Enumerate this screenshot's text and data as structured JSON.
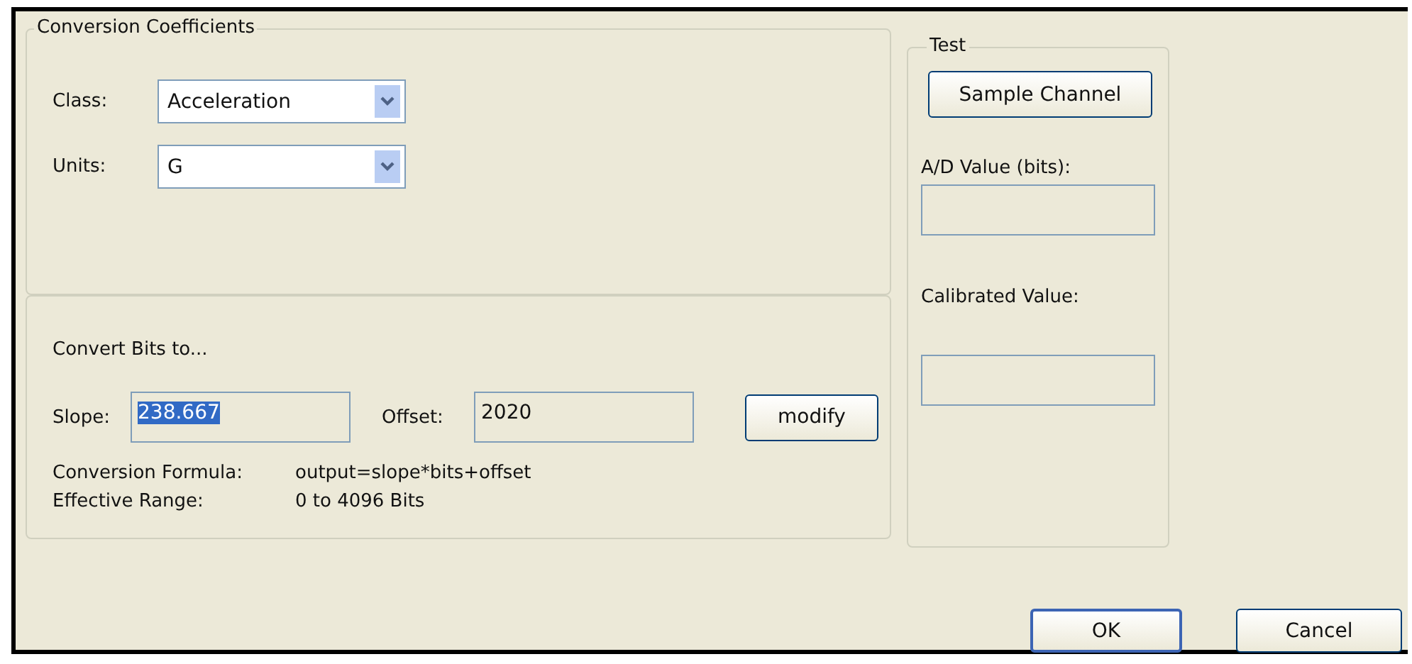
{
  "conversion_coefficients": {
    "title": "Conversion Coefficients",
    "dropdowns": [
      {
        "label": "Class:",
        "value": "Acceleration"
      },
      {
        "label": "Units:",
        "value": "G"
      }
    ]
  },
  "convert": {
    "heading": "Convert Bits to...",
    "slope": {
      "label": "Slope:",
      "value": "238.667",
      "selected": true
    },
    "offset": {
      "label": "Offset:",
      "value": "2020",
      "selected": false
    },
    "modify_button": "modify",
    "info": [
      {
        "label": "Conversion Formula:",
        "value": "output=slope*bits+offset"
      },
      {
        "label": "Effective Range:",
        "value": "0 to 4096 Bits"
      }
    ]
  },
  "test": {
    "title": "Test",
    "sample_button": "Sample Channel",
    "ad_label": "A/D Value (bits):",
    "calibrated_label": "Calibrated Value:"
  },
  "buttons": [
    {
      "label": "OK",
      "default": true
    },
    {
      "label": "Cancel",
      "default": false
    }
  ]
}
